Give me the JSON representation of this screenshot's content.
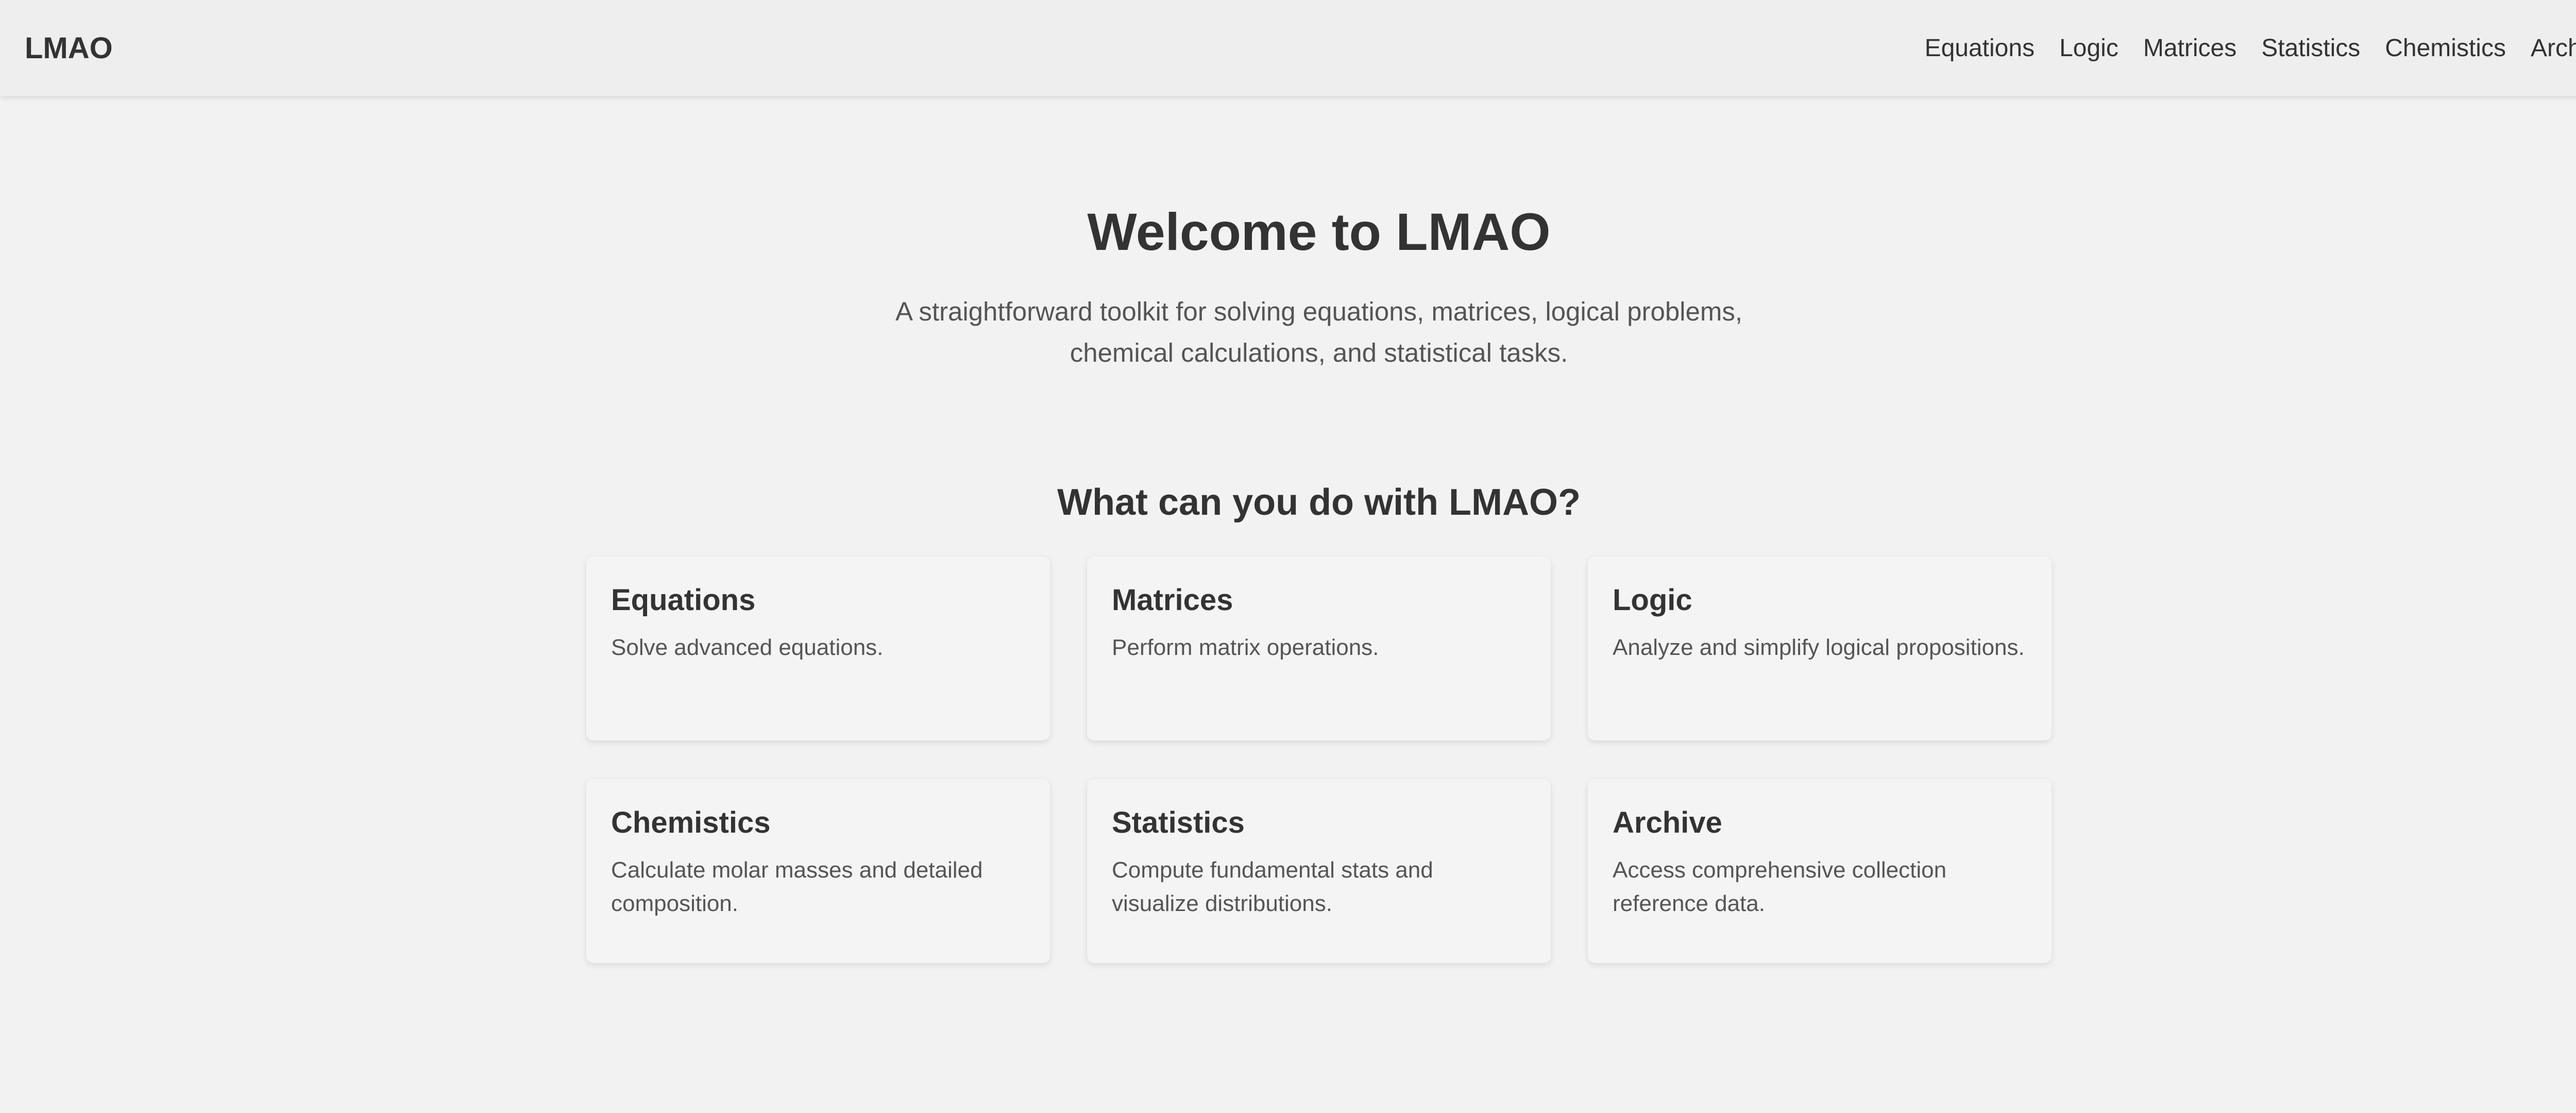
{
  "navbar": {
    "brand": "LMAO",
    "links": [
      "Equations",
      "Logic",
      "Matrices",
      "Statistics",
      "Chemistics",
      "Archive"
    ]
  },
  "hero": {
    "title": "Welcome to LMAO",
    "subtitle": "A straightforward toolkit for solving equations, matrices, logical problems, chemical calculations, and statistical tasks."
  },
  "features": {
    "title": "What can you do with LMAO?",
    "cards": [
      {
        "title": "Equations",
        "description": "Solve advanced equations."
      },
      {
        "title": "Matrices",
        "description": "Perform matrix operations."
      },
      {
        "title": "Logic",
        "description": "Analyze and simplify logical propositions."
      },
      {
        "title": "Chemistics",
        "description": "Calculate molar masses and detailed composition."
      },
      {
        "title": "Statistics",
        "description": "Compute fundamental stats and visualize distributions."
      },
      {
        "title": "Archive",
        "description": "Access comprehensive collection reference data."
      }
    ]
  },
  "colors": {
    "background": "#f2f2f2",
    "navbar": "#eeeeee",
    "card": "#f4f4f4",
    "text": "#333333",
    "muted_text": "#555555"
  }
}
